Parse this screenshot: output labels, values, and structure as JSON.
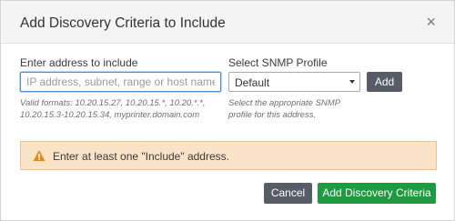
{
  "dialog": {
    "title": "Add Discovery Criteria to Include",
    "close_label": "×"
  },
  "address": {
    "label": "Enter address to include",
    "placeholder": "IP address, subnet, range or host name",
    "value": "",
    "hint": "Valid formats: 10.20.15.27, 10.20.15.*, 10.20.*.*, 10.20.15.3-10.20.15.34, myprinter.domain.com"
  },
  "snmp": {
    "label": "Select SNMP Profile",
    "selected": "Default",
    "hint": "Select the appropriate SNMP profile for this address."
  },
  "buttons": {
    "add": "Add",
    "cancel": "Cancel",
    "submit": "Add Discovery Criteria"
  },
  "alert": {
    "text": "Enter at least one \"Include\" address.",
    "icon": "warning-icon"
  },
  "colors": {
    "primary": "#1e9b3f",
    "secondary": "#585c66",
    "alert_bg": "#fbe3c8",
    "alert_icon": "#e08a1e",
    "focus_border": "#4a8ed6"
  }
}
